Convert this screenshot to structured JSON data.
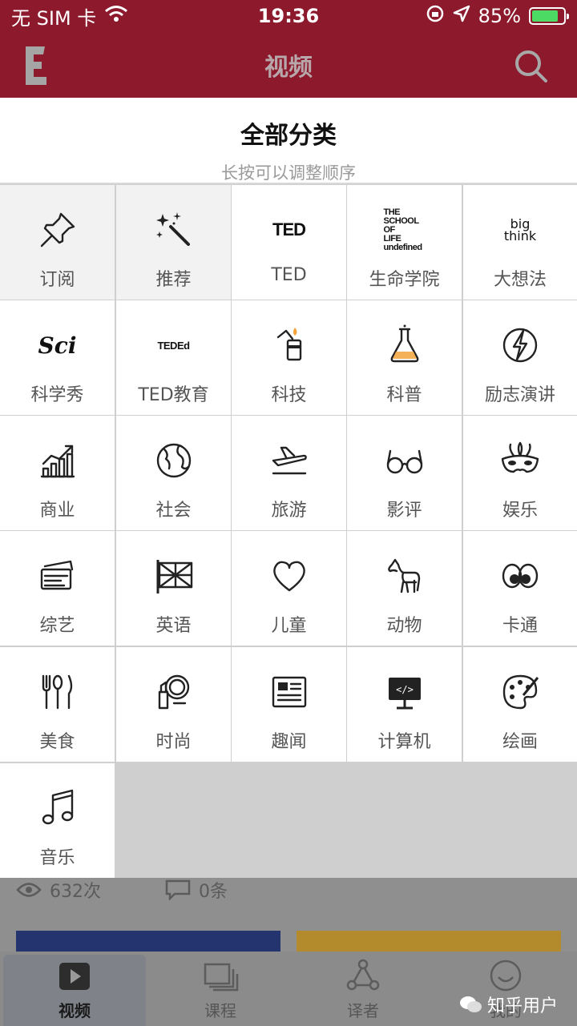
{
  "status_bar": {
    "carrier": "无 SIM 卡",
    "time": "19:36",
    "battery_percent": "85%",
    "battery_level": 0.85
  },
  "nav": {
    "logo_icon": "e-logo-icon",
    "title": "视频",
    "search_icon": "search-icon"
  },
  "sheet": {
    "title": "全部分类",
    "subtitle": "长按可以调整顺序"
  },
  "categories": [
    {
      "label": "订阅",
      "icon": "pin-icon",
      "selected": true
    },
    {
      "label": "推荐",
      "icon": "magic-wand-icon",
      "selected": true
    },
    {
      "label": "TED",
      "icon": "ted-logo-icon",
      "icon_text": "TED"
    },
    {
      "label": "生命学院",
      "icon": "school-of-life-logo-icon",
      "icon_text": "THE SCHOOL OF LIFE"
    },
    {
      "label": "大想法",
      "icon": "big-think-logo-icon",
      "icon_text": "big think"
    },
    {
      "label": "科学秀",
      "icon": "sci-logo-icon",
      "icon_text": "Sci"
    },
    {
      "label": "TED教育",
      "icon": "ted-ed-logo-icon",
      "icon_text": "TEDEd"
    },
    {
      "label": "科技",
      "icon": "lighter-icon"
    },
    {
      "label": "科普",
      "icon": "flask-icon"
    },
    {
      "label": "励志演讲",
      "icon": "lightning-icon"
    },
    {
      "label": "商业",
      "icon": "growth-chart-icon"
    },
    {
      "label": "社会",
      "icon": "globe-icon"
    },
    {
      "label": "旅游",
      "icon": "airplane-icon"
    },
    {
      "label": "影评",
      "icon": "glasses-icon"
    },
    {
      "label": "娱乐",
      "icon": "mask-icon"
    },
    {
      "label": "综艺",
      "icon": "tickets-icon"
    },
    {
      "label": "英语",
      "icon": "uk-flag-icon"
    },
    {
      "label": "儿童",
      "icon": "heart-icon"
    },
    {
      "label": "动物",
      "icon": "horse-icon"
    },
    {
      "label": "卡通",
      "icon": "cartoon-eyes-icon"
    },
    {
      "label": "美食",
      "icon": "cutlery-icon"
    },
    {
      "label": "时尚",
      "icon": "makeup-icon"
    },
    {
      "label": "趣闻",
      "icon": "newspaper-icon"
    },
    {
      "label": "计算机",
      "icon": "computer-icon"
    },
    {
      "label": "绘画",
      "icon": "palette-icon"
    },
    {
      "label": "音乐",
      "icon": "music-note-icon"
    }
  ],
  "background_card": {
    "views": "632次",
    "comments": "0条"
  },
  "tabs": [
    {
      "label": "视频",
      "icon": "play-icon",
      "active": true
    },
    {
      "label": "课程",
      "icon": "stack-icon",
      "active": false
    },
    {
      "label": "译者",
      "icon": "share-nodes-icon",
      "active": false
    },
    {
      "label": "我的",
      "icon": "smile-icon",
      "active": false
    }
  ],
  "watermark": "知乎用户"
}
